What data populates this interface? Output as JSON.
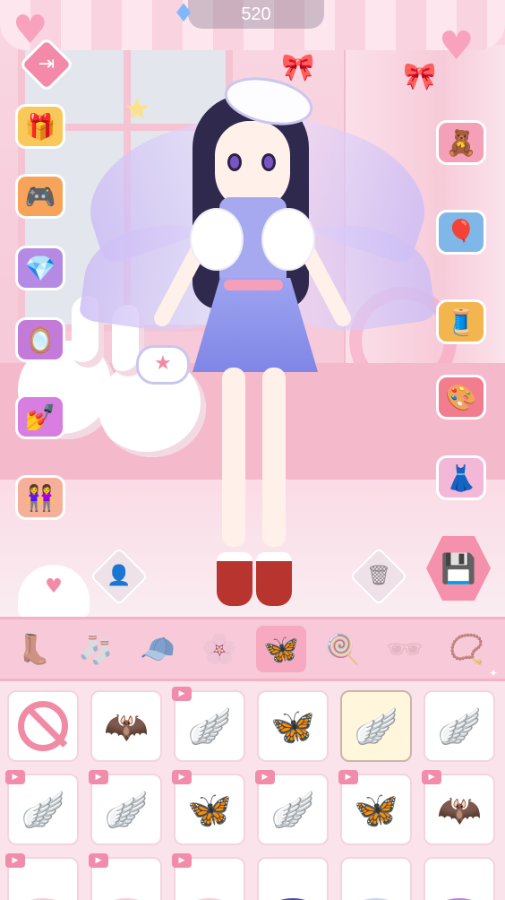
{
  "hud": {
    "gem_count": "520",
    "gem_icon": "diamond-icon",
    "exit_icon": "exit-icon"
  },
  "left_menu": [
    {
      "name": "gift-box",
      "icon": "gift-box-icon",
      "glyph": "🎁",
      "color": "#f9c85a"
    },
    {
      "name": "game-console",
      "icon": "game-console-icon",
      "glyph": "🎮",
      "color": "#f7a35a"
    },
    {
      "name": "heart-box",
      "icon": "heart-box-icon",
      "glyph": "💎",
      "color": "#b58ae5"
    },
    {
      "name": "makeup-compact",
      "icon": "compact-icon",
      "glyph": "🪞",
      "color": "#c47ad9"
    },
    {
      "name": "nail-polish",
      "icon": "nail-polish-icon",
      "glyph": "💅",
      "color": "#d77ee0"
    },
    {
      "name": "friends",
      "icon": "friends-icon",
      "glyph": "👭",
      "color": "#f6b09a"
    }
  ],
  "right_menu": [
    {
      "name": "doll-figure",
      "icon": "doll-figure-icon",
      "glyph": "🧸",
      "color": "#f4a0b8"
    },
    {
      "name": "hot-air-balloon",
      "icon": "hot-air-balloon-icon",
      "glyph": "🎈",
      "color": "#7fb8e8"
    },
    {
      "name": "sewing-machine",
      "icon": "sewing-machine-icon",
      "glyph": "🧵",
      "color": "#f3b64f"
    },
    {
      "name": "art-box",
      "icon": "art-box-icon",
      "glyph": "🎨",
      "color": "#f27d8e"
    },
    {
      "name": "dress-shop",
      "icon": "dress-icon",
      "glyph": "👗",
      "color": "#f3b8d8"
    }
  ],
  "actions": {
    "avatar_icon": "avatar-icon",
    "trash_icon": "trash-icon",
    "save_icon": "save-icon"
  },
  "categories": [
    {
      "name": "boots",
      "icon": "boot-icon",
      "glyph": "👢",
      "active": false
    },
    {
      "name": "socks",
      "icon": "sock-icon",
      "glyph": "🧦",
      "active": false
    },
    {
      "name": "hats",
      "icon": "cap-icon",
      "glyph": "🧢",
      "active": false
    },
    {
      "name": "hair-clip",
      "icon": "flower-clip-icon",
      "glyph": "🌸",
      "active": false
    },
    {
      "name": "wings",
      "icon": "wings-icon",
      "glyph": "🦋",
      "active": true
    },
    {
      "name": "wand",
      "icon": "candy-cane-icon",
      "glyph": "🍭",
      "active": false
    },
    {
      "name": "glasses",
      "icon": "star-glasses-icon",
      "glyph": "🕶",
      "active": false
    },
    {
      "name": "necklace",
      "icon": "bead-necklace-icon",
      "glyph": "📿",
      "active": false
    }
  ],
  "items": [
    {
      "name": "none",
      "icon": "no-item-icon",
      "glyph": "",
      "video": false,
      "selected": false,
      "color": "#f08aa5"
    },
    {
      "name": "dark-wings",
      "icon": "bat-wings-icon",
      "glyph": "🦇",
      "video": false,
      "selected": false,
      "color": "#4b49a8"
    },
    {
      "name": "white-fairy-wings",
      "icon": "fairy-wings-icon",
      "glyph": "🪽",
      "video": true,
      "selected": false,
      "color": "#c9d4f5"
    },
    {
      "name": "pastel-butterfly-wings",
      "icon": "butterfly-wings-icon",
      "glyph": "🦋",
      "video": false,
      "selected": false,
      "color": "#c9b8f0"
    },
    {
      "name": "purple-fairy-wings",
      "icon": "fairy-wings-icon",
      "glyph": "🪽",
      "video": false,
      "selected": true,
      "color": "#cfc2f3"
    },
    {
      "name": "green-fairy-wings",
      "icon": "leaf-wings-icon",
      "glyph": "🪽",
      "video": false,
      "selected": false,
      "color": "#c8ea84"
    },
    {
      "name": "pink-feather-wings",
      "icon": "feather-wings-icon",
      "glyph": "🪽",
      "video": true,
      "selected": false,
      "color": "#f8c5d4"
    },
    {
      "name": "small-white-wings",
      "icon": "small-wings-icon",
      "glyph": "🪽",
      "video": true,
      "selected": false,
      "color": "#e4e7ee"
    },
    {
      "name": "purple-butterfly-wings",
      "icon": "butterfly-wings-icon",
      "glyph": "🦋",
      "video": true,
      "selected": false,
      "color": "#b67fe0"
    },
    {
      "name": "pink-angel-wings",
      "icon": "angel-wings-icon",
      "glyph": "🪽",
      "video": true,
      "selected": false,
      "color": "#f4cfd8"
    },
    {
      "name": "gradient-butterfly-wings",
      "icon": "butterfly-wings-icon",
      "glyph": "🦋",
      "video": true,
      "selected": false,
      "color": "#a98ff0"
    },
    {
      "name": "pink-bat-wings",
      "icon": "bat-wings-icon",
      "glyph": "🦇",
      "video": true,
      "selected": false,
      "color": "#f0b7c5"
    },
    {
      "name": "wings-row3-1",
      "icon": "wings-icon",
      "glyph": "",
      "video": true,
      "selected": false,
      "color": "#f4cfd8"
    },
    {
      "name": "wings-row3-2",
      "icon": "wings-icon",
      "glyph": "",
      "video": true,
      "selected": false,
      "color": "#f4cfd8"
    },
    {
      "name": "wings-row3-3",
      "icon": "wings-icon",
      "glyph": "",
      "video": true,
      "selected": false,
      "color": "#f4cfd8"
    },
    {
      "name": "wings-row3-4",
      "icon": "wings-icon",
      "glyph": "",
      "video": false,
      "selected": false,
      "color": "#4b49a8"
    },
    {
      "name": "wings-row3-5",
      "icon": "wings-icon",
      "glyph": "",
      "video": false,
      "selected": false,
      "color": "#c9d4f5"
    },
    {
      "name": "wings-row3-6",
      "icon": "wings-icon",
      "glyph": "",
      "video": false,
      "selected": false,
      "color": "#b67fe0"
    }
  ],
  "colors": {
    "accent": "#f48aa9",
    "category_bar": "#f8c9d8",
    "selected_item": "#fff6dc"
  }
}
